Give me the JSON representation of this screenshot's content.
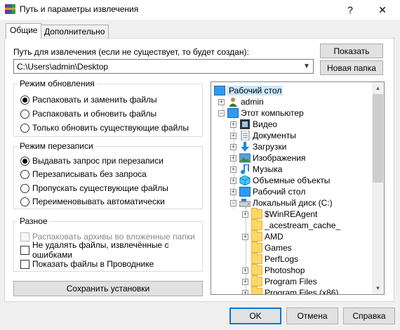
{
  "window": {
    "title": "Путь и параметры извлечения",
    "help_glyph": "?",
    "close_glyph": "✕"
  },
  "tabs": [
    {
      "label": "Общие"
    },
    {
      "label": "Дополнительно"
    }
  ],
  "path": {
    "label": "Путь для извлечения (если не существует, то будет создан):",
    "value": "C:\\Users\\admin\\Desktop"
  },
  "buttons": {
    "show": "Показать",
    "new_folder": "Новая папка",
    "save_settings": "Сохранить установки",
    "ok": "OK",
    "cancel": "Отмена",
    "help": "Справка"
  },
  "update_mode": {
    "title": "Режим обновления",
    "options": [
      {
        "label": "Распаковать и заменить файлы",
        "selected": true
      },
      {
        "label": "Распаковать и обновить файлы",
        "selected": false
      },
      {
        "label": "Только обновить существующие файлы",
        "selected": false
      }
    ]
  },
  "overwrite_mode": {
    "title": "Режим перезаписи",
    "options": [
      {
        "label": "Выдавать запрос при перезаписи",
        "selected": true
      },
      {
        "label": "Перезаписывать без запроса",
        "selected": false
      },
      {
        "label": "Пропускать существующие файлы",
        "selected": false
      },
      {
        "label": "Переименовывать автоматически",
        "selected": false
      }
    ]
  },
  "misc": {
    "title": "Разное",
    "options": [
      {
        "label": "Распаковать архивы во вложенные папки",
        "checked": false,
        "disabled": true
      },
      {
        "label": "Не удалять файлы, извлечённые с ошибками",
        "checked": false,
        "disabled": false
      },
      {
        "label": "Показать файлы в Проводнике",
        "checked": false,
        "disabled": false
      }
    ]
  },
  "tree": {
    "items": [
      {
        "label": "Рабочий стол",
        "icon": "desktop-icon",
        "selected": true
      },
      {
        "label": "admin",
        "icon": "user-icon"
      },
      {
        "label": "Этот компьютер",
        "icon": "computer-icon"
      },
      {
        "label": "Видео",
        "icon": "video-icon"
      },
      {
        "label": "Документы",
        "icon": "documents-icon"
      },
      {
        "label": "Загрузки",
        "icon": "downloads-icon"
      },
      {
        "label": "Изображения",
        "icon": "pictures-icon"
      },
      {
        "label": "Музыка",
        "icon": "music-icon"
      },
      {
        "label": "Объемные объекты",
        "icon": "3d-objects-icon"
      },
      {
        "label": "Рабочий стол",
        "icon": "desktop-icon"
      },
      {
        "label": "Локальный диск (C:)",
        "icon": "drive-icon"
      },
      {
        "label": "$WinREAgent",
        "icon": "folder-icon"
      },
      {
        "label": "_acestream_cache_",
        "icon": "folder-icon"
      },
      {
        "label": "AMD",
        "icon": "folder-icon"
      },
      {
        "label": "Games",
        "icon": "folder-icon"
      },
      {
        "label": "PerfLogs",
        "icon": "folder-icon"
      },
      {
        "label": "Photoshop",
        "icon": "folder-icon"
      },
      {
        "label": "Program Files",
        "icon": "folder-icon"
      },
      {
        "label": "Program Files (x86)",
        "icon": "folder-icon"
      }
    ]
  },
  "colors": {
    "accent": "#0078d7",
    "selection": "#cce8ff",
    "folder": "#ffd766"
  }
}
